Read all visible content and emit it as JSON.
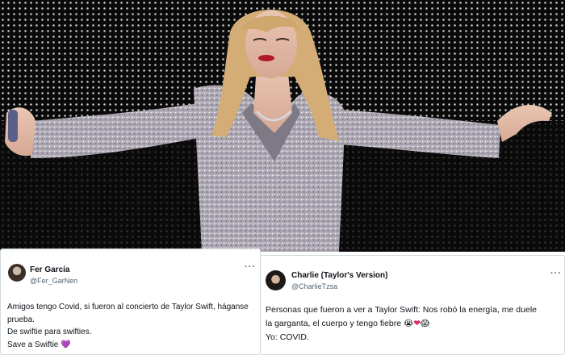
{
  "tweets": [
    {
      "name": "Fer García",
      "handle": "@Fer_GarNen",
      "more": "···",
      "lines": [
        "Amigos tengo Covid, si fueron al concierto de Taylor Swift, háganse",
        "prueba.",
        "De swiftie para swifties.",
        "Save a Swiftie"
      ],
      "emoji": "💜"
    },
    {
      "name": "Charlie (Taylor's Version)",
      "handle": "@CharlieTzsa",
      "more": "···",
      "lines": [
        "Personas que fueron a ver a Taylor Swift: Nos robó la energía, me duele",
        "la garganta, el cuerpo y tengo fiebre",
        "Yo: COVID."
      ],
      "emojis": [
        "😭",
        "❤",
        "😱"
      ]
    }
  ],
  "colors": {
    "name": "#0f1419",
    "handle": "#536471",
    "card_border": "#cfd9de",
    "jacket": "#b9b4bf",
    "hair": "#d8b27a"
  }
}
